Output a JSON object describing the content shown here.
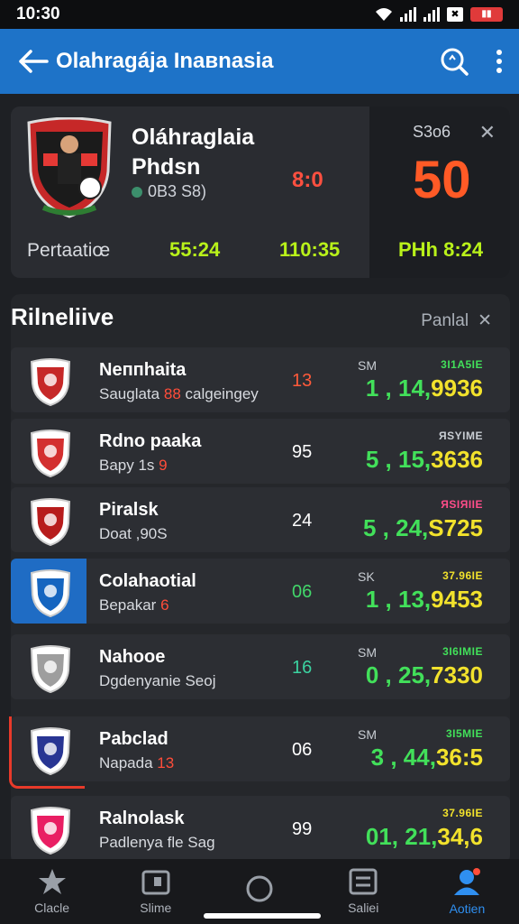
{
  "status_bar": {
    "time": "10:30"
  },
  "app_bar": {
    "title": "Olahragája Inaвnasia"
  },
  "match": {
    "team_name": "Oláhraglaia Phdsn",
    "meta": "0B3 S8)",
    "live_score": "8:0",
    "period_label": "Pertaatiœ",
    "time_a": "55:24",
    "time_b": "110:35",
    "right_label": "S3о6",
    "big_score": "50",
    "right_time": "PHh 8:24"
  },
  "list": {
    "title": "Rilneliive",
    "action_label": "Panlal",
    "rows": [
      {
        "name": "Neппhaita",
        "sub": "Sauglata",
        "sub_accent": "88",
        "sub_tail": "calgeingey",
        "num": "13",
        "tag": "SM",
        "tag2": "3I1A5IE",
        "val_a": "1 , 14,",
        "val_b": "9936",
        "logo_color": "#c62828"
      },
      {
        "name": "Rdno paaka",
        "sub": "Bapy 1s",
        "sub_accent": "9",
        "sub_tail": "",
        "num": "95",
        "tag": "",
        "tag2": "ЯSYIME",
        "val_a": "5 , 15,",
        "val_b": "3636",
        "logo_color": "#d32f2f"
      },
      {
        "name": "Piralsk",
        "sub": "Doat ,90S",
        "sub_accent": "",
        "sub_tail": "",
        "num": "24",
        "tag": "",
        "tag2": "ЯSIЯIIE",
        "val_a": "5 , 24,",
        "val_b": "S725",
        "logo_color": "#b71c1c"
      },
      {
        "name": "Colahaotial",
        "sub": "Bepakar",
        "sub_accent": "6",
        "sub_tail": "",
        "num": "06",
        "tag": "SK",
        "tag2": "37.96IE",
        "val_a": "1 , 13,",
        "val_b": "9453",
        "logo_color": "#1565c0"
      },
      {
        "name": "Nahooe",
        "sub": "Dgdenyanie Seoj",
        "sub_accent": "",
        "sub_tail": "",
        "num": "16",
        "tag": "SM",
        "tag2": "3I6IMIE",
        "val_a": "0 , 25,",
        "val_b": "7330",
        "logo_color": "#9e9e9e"
      },
      {
        "name": "Pabclad",
        "sub": "Napada",
        "sub_accent": "13",
        "sub_tail": "",
        "num": "06",
        "tag": "SM",
        "tag2": "3I5MIE",
        "val_a": "3 , 44,",
        "val_b": "36:5",
        "logo_color": "#283593"
      },
      {
        "name": "Ralnolask",
        "sub": "Padlenya fle Sag",
        "sub_accent": "",
        "sub_tail": "",
        "num": "99",
        "tag": "",
        "tag2": "37.96IE",
        "val_a": "01, 21,",
        "val_b": "34,6",
        "logo_color": "#e91e63"
      }
    ]
  },
  "bottom_nav": [
    {
      "label": "Clacle",
      "icon": "star-icon"
    },
    {
      "label": "Slime",
      "icon": "calendar-icon"
    },
    {
      "label": "",
      "icon": "home-circle-icon"
    },
    {
      "label": "Saliei",
      "icon": "list-icon"
    },
    {
      "label": "Aotien",
      "icon": "account-icon"
    }
  ],
  "colors": {
    "accent": "#1e73c8",
    "live_red": "#ff5a26",
    "time_green": "#b9f21a"
  }
}
